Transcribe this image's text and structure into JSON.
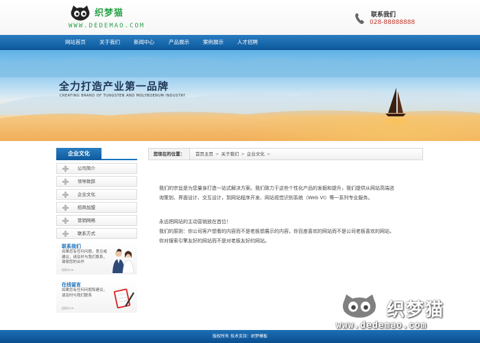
{
  "header": {
    "logo_cn": "织梦猫",
    "logo_url": "WWW.DEDEMAO.COM",
    "contact_title": "联系我们",
    "contact_phone": "028-88888888"
  },
  "nav": {
    "items": [
      "网站首页",
      "关于我们",
      "新闻中心",
      "产品展示",
      "案例展示",
      "人才招聘"
    ]
  },
  "banner": {
    "title": "全力打造产业第一品牌",
    "subtitle": "CREATING BRAND OF TUNGSTEN AND MOLYBDENUM INDUSTRY"
  },
  "sidebar": {
    "title": "企业文化",
    "items": [
      "公司简介",
      "领导致辞",
      "企业文化",
      "招商加盟",
      "营销网络",
      "联系方式"
    ],
    "contact_box": {
      "title": "联系我们",
      "text": "如果您有任何问题，意见或建议，请及时与我们联系，谢谢您的合作",
      "go": "GO>>"
    },
    "message_box": {
      "title": "在线留言",
      "text": "如果您有任何问题和建议，请及时与我们联系",
      "go": "GO>>"
    }
  },
  "breadcrumb": {
    "label": "您现在的位置：",
    "items": [
      "首页主页",
      "关于我们",
      "企业文化"
    ],
    "separator": ">"
  },
  "content": {
    "para1_line1": "我们的宗旨是为您量身打造一站式解决方案。我们致力于这些个性化产品的发掘和提升，我们提供从网站高端咨",
    "para1_line2": "询策划、界面设计、交互设计，到网站程序开发、网站视觉识别系统（Web VI）等一系列专业服务。",
    "para2_line1": "永远把网站的主动营销放在首位！",
    "para2_line2": "我们的原则：你公司客户想看的内容而不是老板想展示的内容，你百度喜欢的网站而不是公司老板喜欢的网站，",
    "para2_line3": "你对搜索引擎友好的网站而不是对老板友好的网站。"
  },
  "footer": {
    "text": "版权所有  技术支持：织梦模板"
  },
  "watermark": {
    "cn": "织梦猫",
    "url": "www.dedemao.com"
  },
  "colors": {
    "nav_blue": "#1a6eb8",
    "accent_green": "#2aa34a",
    "phone_red": "#c0392b"
  }
}
